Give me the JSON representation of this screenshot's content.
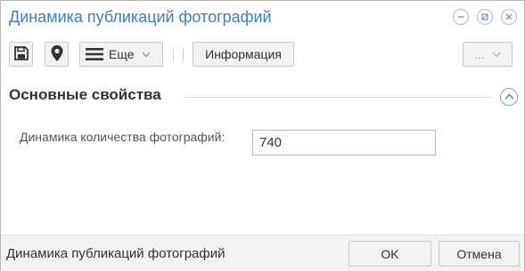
{
  "window": {
    "title": "Динамика публикаций фотографий",
    "accent_color": "#3b7ec4",
    "controls": [
      "minimize-icon",
      "restore-icon",
      "close-icon"
    ]
  },
  "toolbar": {
    "save_icon": "save-icon",
    "location_icon": "map-pin-icon",
    "menu_icon": "hamburger-icon",
    "more_label": "Еще",
    "info_label": "Информация",
    "overflow_label": "..."
  },
  "section": {
    "title": "Основные свойства",
    "collapse_icon": "chevron-up-icon"
  },
  "form": {
    "field_label": "Динамика количества фотографий:",
    "field_value": "740"
  },
  "footer": {
    "text": "Динамика публикаций фотографий",
    "ok_label": "OK",
    "cancel_label": "Отмена"
  }
}
